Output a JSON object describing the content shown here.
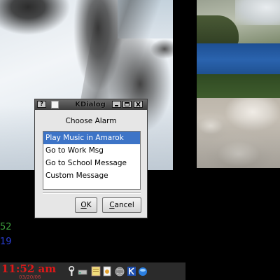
{
  "dialog": {
    "title": "KDialog",
    "prompt": "Choose Alarm",
    "items": [
      {
        "label": "Play Music in Amarok",
        "selected": true
      },
      {
        "label": "Go to Work Msg",
        "selected": false
      },
      {
        "label": "Go to School Message",
        "selected": false
      },
      {
        "label": "Custom Message",
        "selected": false
      }
    ],
    "titlebar_buttons": {
      "help": "?"
    },
    "ok_prefix": "O",
    "ok_rest": "K",
    "cancel_prefix": "C",
    "cancel_rest": "ancel"
  },
  "side_counters": {
    "green": "52",
    "blue": "19"
  },
  "taskbar": {
    "time": "11:52 am",
    "date": "03/20/06"
  },
  "colors": {
    "selection": "#3d74c7",
    "clock": "#e01818",
    "green_counter": "#3d9e3d",
    "blue_counter": "#2b3fd8"
  },
  "icons": {
    "tray": [
      "tool-icon",
      "drive-icon",
      "note-icon",
      "document-icon",
      "globe-icon",
      "kde-k-icon",
      "blue-orb-icon"
    ]
  }
}
